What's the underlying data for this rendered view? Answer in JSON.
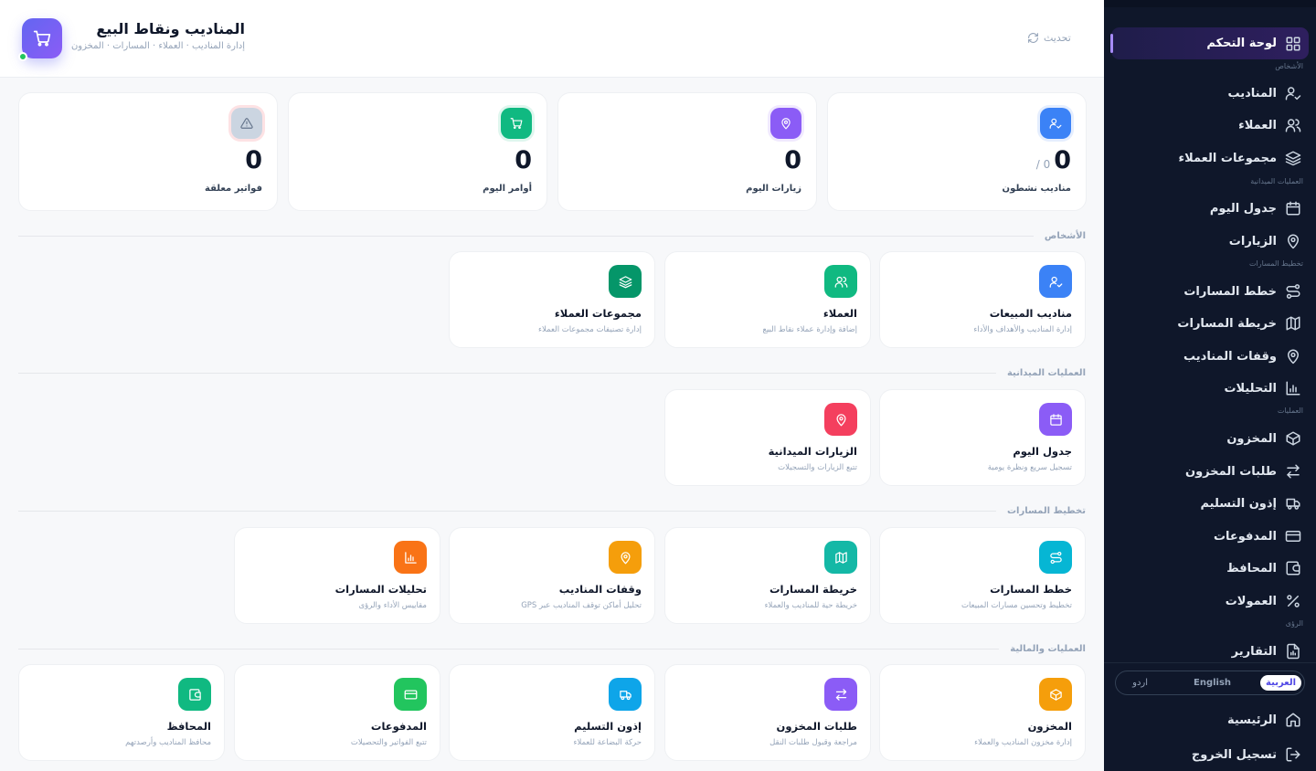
{
  "header": {
    "title": "المناديب ونقاط البيع",
    "subtitle": "إدارة المناديب · العملاء · المسارات · المخزون",
    "refresh_label": "تحديث"
  },
  "stats": [
    {
      "value": "0",
      "of": "0 /",
      "label": "مناديب نشطون",
      "icon": "user-check-icon",
      "color": "#3b82f6"
    },
    {
      "value": "0",
      "label": "زيارات اليوم",
      "icon": "map-pin-icon",
      "color": "#8b5cf6"
    },
    {
      "value": "0",
      "label": "أوامر اليوم",
      "icon": "cart-icon",
      "color": "#10b981"
    },
    {
      "value": "0",
      "label": "فواتير معلقة",
      "icon": "alert-icon",
      "color": "#cbd5e1"
    }
  ],
  "sections": {
    "people": "الأشخاص",
    "field": "العمليات الميدانية",
    "routes": "تخطيط المسارات",
    "ops": "العمليات والمالية"
  },
  "cards": {
    "people": [
      {
        "title": "مناديب المبيعات",
        "desc": "إدارة المناديب والأهداف والأداء",
        "icon": "user-check-icon",
        "color": "#3b82f6"
      },
      {
        "title": "العملاء",
        "desc": "إضافة وإدارة عملاء نقاط البيع",
        "icon": "users-icon",
        "color": "#10b981"
      },
      {
        "title": "مجموعات العملاء",
        "desc": "إدارة تصنيفات مجموعات العملاء",
        "icon": "layers-icon",
        "color": "#059669"
      }
    ],
    "field": [
      {
        "title": "جدول اليوم",
        "desc": "تسجيل سريع ونظرة يومية",
        "icon": "calendar-icon",
        "color": "#8b5cf6"
      },
      {
        "title": "الزيارات الميدانية",
        "desc": "تتبع الزيارات والتسجيلات",
        "icon": "map-pin-icon",
        "color": "#f43f5e"
      }
    ],
    "routes": [
      {
        "title": "خطط المسارات",
        "desc": "تخطيط وتحسين مسارات المبيعات",
        "icon": "route-icon",
        "color": "#06b6d4"
      },
      {
        "title": "خريطة المسارات",
        "desc": "خريطة حية للمناديب والعملاء",
        "icon": "map-icon",
        "color": "#14b8a6"
      },
      {
        "title": "وقفات المناديب",
        "desc": "تحليل أماكن توقف المناديب عبر GPS",
        "icon": "map-pin-icon",
        "color": "#f59e0b"
      },
      {
        "title": "تحليلات المسارات",
        "desc": "مقاييس الأداء والرؤى",
        "icon": "bar-chart-icon",
        "color": "#f97316"
      }
    ],
    "ops": [
      {
        "title": "المخزون",
        "desc": "إدارة مخزون المناديب والعملاء",
        "icon": "box-icon",
        "color": "#f59e0b"
      },
      {
        "title": "طلبات المخزون",
        "desc": "مراجعة وقبول طلبات النقل",
        "icon": "transfer-icon",
        "color": "#8b5cf6"
      },
      {
        "title": "إذون التسليم",
        "desc": "حركة البضاعة للعملاء",
        "icon": "truck-icon",
        "color": "#0ea5e9"
      },
      {
        "title": "المدفوعات",
        "desc": "تتبع الفواتير والتحصيلات",
        "icon": "card-icon",
        "color": "#22c55e"
      },
      {
        "title": "المحافظ",
        "desc": "محافظ المناديب وأرصدتهم",
        "icon": "wallet-icon",
        "color": "#10b981"
      }
    ]
  },
  "sidebar": {
    "active": {
      "label": "لوحة التحكم",
      "icon": "grid-icon"
    },
    "sections": {
      "people": "الأشخاص",
      "field": "العمليات الميدانية",
      "routes": "تخطيط المسارات",
      "ops": "العمليات",
      "insights": "الرؤى"
    },
    "items": [
      {
        "label": "المناديب",
        "icon": "user-check-icon"
      },
      {
        "label": "العملاء",
        "icon": "users-icon"
      },
      {
        "label": "مجموعات العملاء",
        "icon": "layers-icon"
      },
      {
        "label": "جدول اليوم",
        "icon": "calendar-icon"
      },
      {
        "label": "الزيارات",
        "icon": "map-pin-icon"
      },
      {
        "label": "خطط المسارات",
        "icon": "route-icon"
      },
      {
        "label": "خريطة المسارات",
        "icon": "map-icon"
      },
      {
        "label": "وقفات المناديب",
        "icon": "map-pin-icon"
      },
      {
        "label": "التحليلات",
        "icon": "bar-chart-icon"
      },
      {
        "label": "المخزون",
        "icon": "box-icon"
      },
      {
        "label": "طلبات المخزون",
        "icon": "transfer-icon"
      },
      {
        "label": "إذون التسليم",
        "icon": "truck-icon"
      },
      {
        "label": "المدفوعات",
        "icon": "card-icon"
      },
      {
        "label": "المحافظ",
        "icon": "wallet-icon"
      },
      {
        "label": "العمولات",
        "icon": "percent-icon"
      },
      {
        "label": "التقارير",
        "icon": "report-icon"
      }
    ],
    "languages": [
      "العربية",
      "English",
      "اردو"
    ],
    "home_label": "الرئيسية",
    "logout_label": "تسجيل الخروج"
  }
}
